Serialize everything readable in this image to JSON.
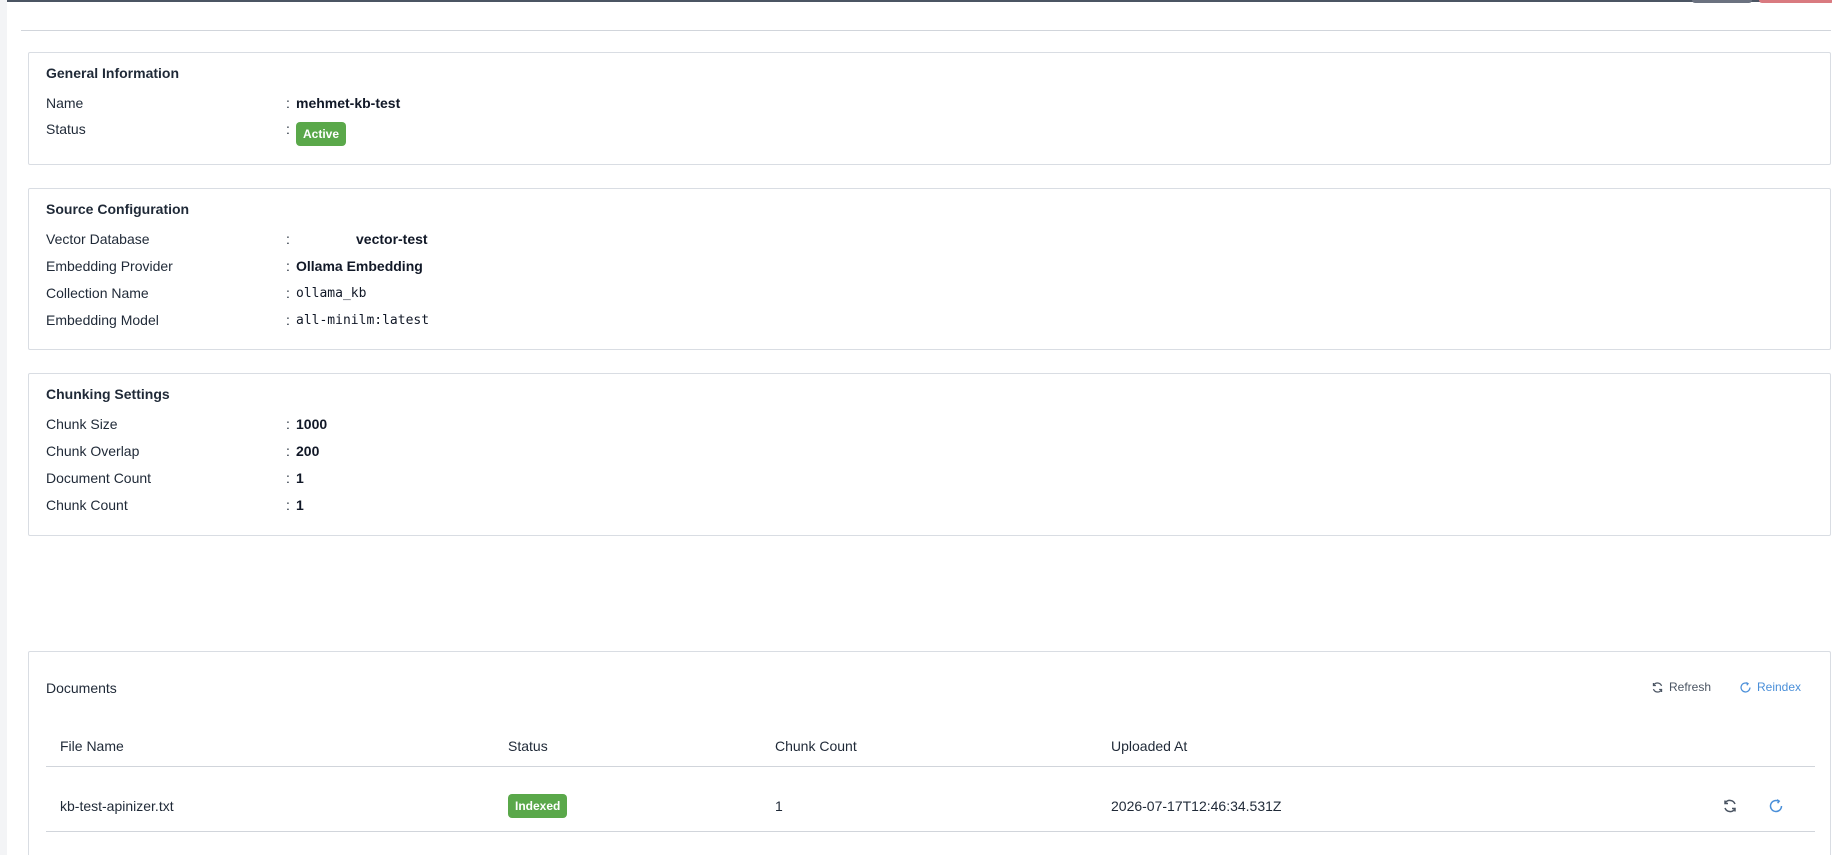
{
  "general": {
    "title": "General Information",
    "name_label": "Name",
    "name_value": "mehmet-kb-test",
    "status_label": "Status",
    "status_value": "Active"
  },
  "source": {
    "title": "Source Configuration",
    "vector_db_label": "Vector Database",
    "vector_db_value": "vector-test",
    "embedding_provider_label": "Embedding Provider",
    "embedding_provider_value": "Ollama Embedding",
    "collection_label": "Collection Name",
    "collection_value": "ollama_kb",
    "embedding_model_label": "Embedding Model",
    "embedding_model_value": "all-minilm:latest"
  },
  "chunking": {
    "title": "Chunking Settings",
    "chunk_size_label": "Chunk Size",
    "chunk_size_value": "1000",
    "chunk_overlap_label": "Chunk Overlap",
    "chunk_overlap_value": "200",
    "document_count_label": "Document Count",
    "document_count_value": "1",
    "chunk_count_label": "Chunk Count",
    "chunk_count_value": "1"
  },
  "documents": {
    "title": "Documents",
    "refresh_label": "Refresh",
    "reindex_label": "Reindex",
    "columns": [
      "File Name",
      "Status",
      "Chunk Count",
      "Uploaded At"
    ],
    "rows": [
      {
        "file_name": "kb-test-apinizer.txt",
        "status": "Indexed",
        "chunk_count": "1",
        "uploaded_at": "2026-07-17T12:46:34.531Z"
      }
    ]
  },
  "colon": ":",
  "colors": {
    "success": "#5aa84a",
    "link": "#4a8fd9"
  }
}
